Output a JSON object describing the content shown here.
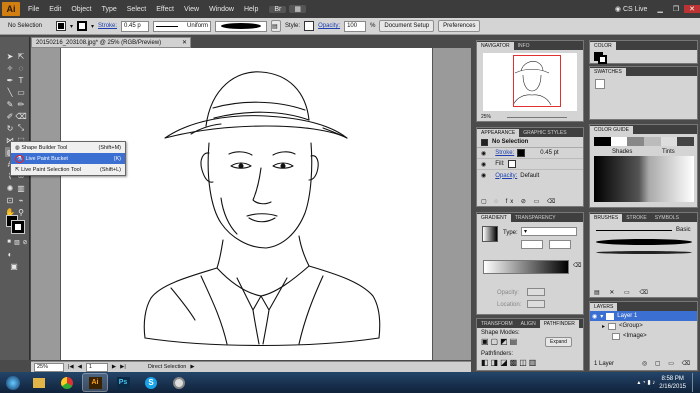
{
  "menubar": {
    "logo": "Ai",
    "items": [
      "File",
      "Edit",
      "Object",
      "Type",
      "Select",
      "Effect",
      "View",
      "Window",
      "Help"
    ],
    "cs_live": "CS Live"
  },
  "control": {
    "selection": "No Selection",
    "stroke_label": "Stroke:",
    "stroke_value": "0.45 p",
    "profile": "Uniform",
    "style_label": "Style:",
    "opacity_label": "Opacity:",
    "opacity_value": "100",
    "opacity_unit": "%",
    "document_setup": "Document Setup",
    "preferences": "Preferences"
  },
  "document": {
    "tab_title": "20150216_203108.jpg* @ 25% (RGB/Preview)"
  },
  "flyout": {
    "items": [
      {
        "label": "Shape Builder Tool",
        "shortcut": "(Shift+M)"
      },
      {
        "label": "Live Paint Bucket",
        "shortcut": "(K)"
      },
      {
        "label": "Live Paint Selection Tool",
        "shortcut": "(Shift+L)"
      }
    ]
  },
  "status": {
    "zoom": "25%",
    "page": "1",
    "tool": "Direct Selection"
  },
  "navigator": {
    "tabs": [
      "NAVIGATOR",
      "INFO"
    ],
    "zoom": "25%"
  },
  "appearance": {
    "tabs": [
      "APPEARANCE",
      "GRAPHIC STYLES"
    ],
    "header": "No Selection",
    "stroke_label": "Stroke:",
    "stroke_value": "0.45 pt",
    "fill_label": "Fill:",
    "opacity_label": "Opacity:",
    "opacity_value": "Default"
  },
  "gradient": {
    "tabs": [
      "GRADIENT",
      "TRANSPARENCY"
    ],
    "type_label": "Type:",
    "opacity_label": "Opacity:",
    "location_label": "Location:"
  },
  "pathfinder": {
    "tabs": [
      "TRANSFORM",
      "ALIGN",
      "PATHFINDER"
    ],
    "shape_modes": "Shape Modes:",
    "pathfinders": "Pathfinders:",
    "expand": "Expand"
  },
  "color": {
    "tabs": [
      "COLOR"
    ]
  },
  "swatches": {
    "tabs": [
      "SWATCHES"
    ]
  },
  "color_guide": {
    "tabs": [
      "COLOR GUIDE"
    ],
    "shades": "Shades",
    "tints": "Tints"
  },
  "brushes": {
    "tabs": [
      "BRUSHES",
      "STROKE",
      "SYMBOLS"
    ],
    "basic": "Basic"
  },
  "layers": {
    "tabs": [
      "LAYERS"
    ],
    "rows": [
      {
        "name": "Layer 1"
      },
      {
        "name": "<Group>"
      },
      {
        "name": "<Image>"
      }
    ],
    "count": "1 Layer"
  },
  "taskbar": {
    "time": "8:58 PM",
    "date": "2/16/2015"
  },
  "colors": {
    "accent": "#d27f12",
    "selection": "#3b6fd1"
  }
}
